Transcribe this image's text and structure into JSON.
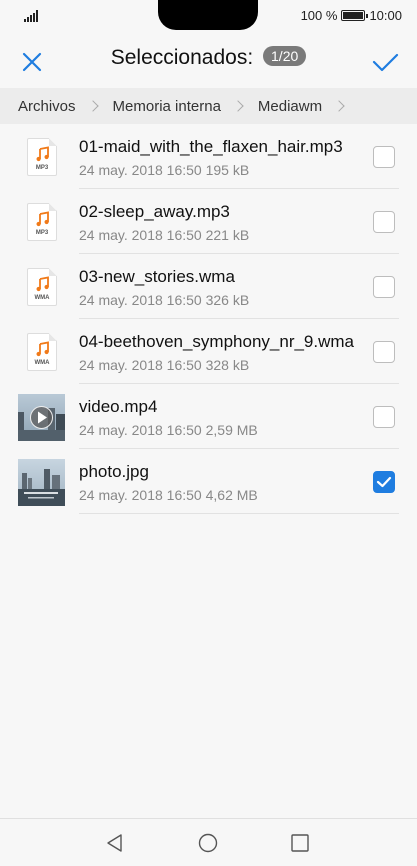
{
  "status": {
    "battery_text": "100 %",
    "time": "10:00"
  },
  "header": {
    "title": "Seleccionados:",
    "count": "1/20",
    "accent_color": "#1f7de0"
  },
  "breadcrumb": [
    "Archivos",
    "Memoria interna",
    "Mediawm"
  ],
  "files": [
    {
      "name": "01-maid_with_the_flaxen_hair.mp3",
      "date": "24 may. 2018 16:50",
      "size": "195 kB",
      "icon": "audio-file-icon",
      "ext": "MP3",
      "checked": false
    },
    {
      "name": "02-sleep_away.mp3",
      "date": "24 may. 2018 16:50",
      "size": "221 kB",
      "icon": "audio-file-icon",
      "ext": "MP3",
      "checked": false
    },
    {
      "name": "03-new_stories.wma",
      "date": "24 may. 2018 16:50",
      "size": "326 kB",
      "icon": "audio-file-icon",
      "ext": "WMA",
      "checked": false
    },
    {
      "name": "04-beethoven_symphony_nr_9.wma",
      "date": "24 may. 2018 16:50",
      "size": "328 kB",
      "icon": "audio-file-icon",
      "ext": "WMA",
      "checked": false
    },
    {
      "name": "video.mp4",
      "date": "24 may. 2018 16:50",
      "size": "2,59 MB",
      "icon": "video-thumbnail",
      "ext": "",
      "checked": false
    },
    {
      "name": "photo.jpg",
      "date": "24 may. 2018 16:50",
      "size": "4,62 MB",
      "icon": "photo-thumbnail",
      "ext": "",
      "checked": true
    }
  ],
  "nav": {
    "icons": [
      "back-icon",
      "home-icon",
      "recent-apps-icon"
    ]
  }
}
